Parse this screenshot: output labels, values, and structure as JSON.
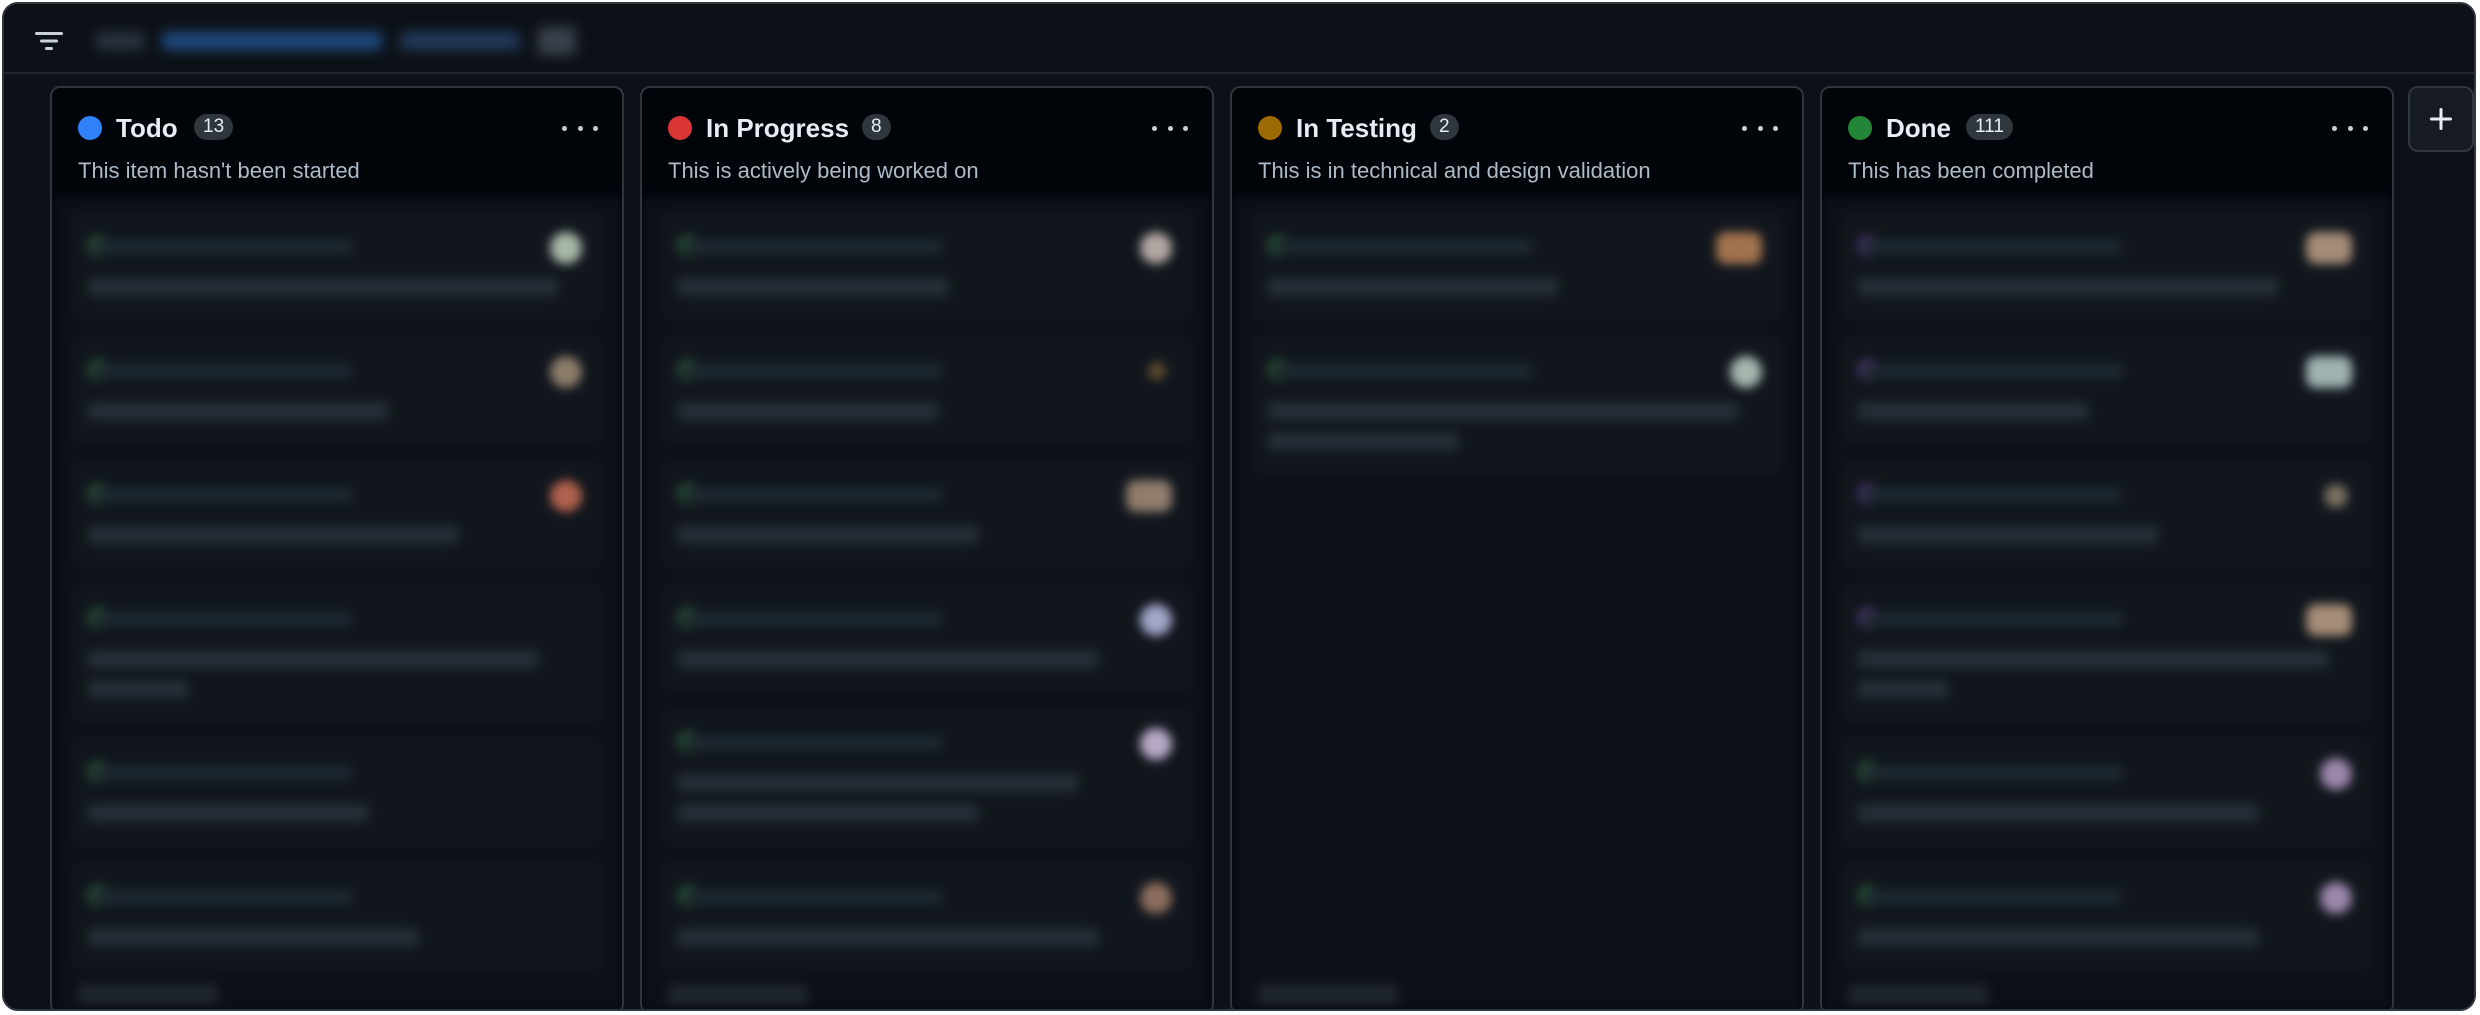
{
  "toolbar": {
    "filter_icon": "filter-icon"
  },
  "columns": [
    {
      "title": "Todo",
      "count": "13",
      "description": "This item hasn't been started",
      "color": "#2f81f7"
    },
    {
      "title": "In Progress",
      "count": "8",
      "description": "This is actively being worked on",
      "color": "#da3633"
    },
    {
      "title": "In Testing",
      "count": "2",
      "description": "This is in technical and design validation",
      "color": "#9e6a03"
    },
    {
      "title": "Done",
      "count": "111",
      "description": "This has been completed",
      "color": "#238636"
    }
  ],
  "add_column": {
    "icon": "plus-icon"
  }
}
